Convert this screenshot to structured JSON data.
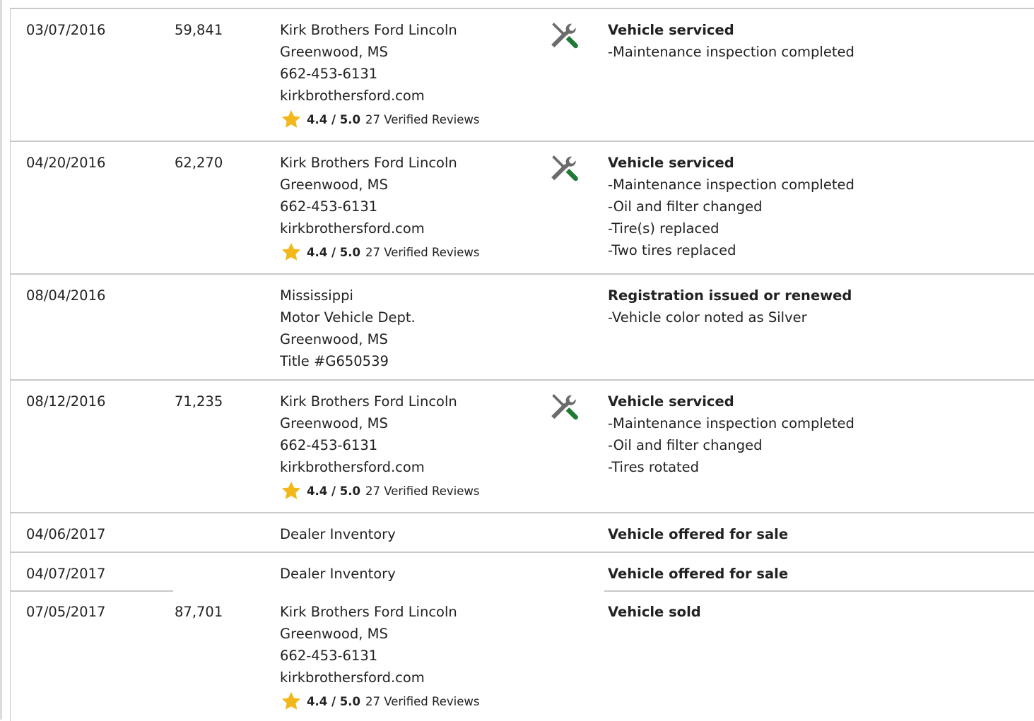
{
  "colors": {
    "star": "#f2b81b",
    "wrench_handle": "#1f7a35",
    "tool_gray": "#6b6b6b",
    "divider": "#c9c9c9"
  },
  "icons": {
    "service": "service-wrench-screwdriver-icon",
    "rating": "star-icon"
  },
  "rows": [
    {
      "date": "03/07/2016",
      "odometer": "59,841",
      "source": [
        "Kirk Brothers Ford Lincoln",
        "Greenwood, MS",
        "662-453-6131",
        "kirkbrothersford.com"
      ],
      "rating": {
        "score": "4.4 / 5.0",
        "reviews": "27 Verified Reviews"
      },
      "service_icon": true,
      "event": "Vehicle serviced",
      "details": [
        "-Maintenance inspection completed"
      ]
    },
    {
      "date": "04/20/2016",
      "odometer": "62,270",
      "source": [
        "Kirk Brothers Ford Lincoln",
        "Greenwood, MS",
        "662-453-6131",
        "kirkbrothersford.com"
      ],
      "rating": {
        "score": "4.4 / 5.0",
        "reviews": "27 Verified Reviews"
      },
      "service_icon": true,
      "event": "Vehicle serviced",
      "details": [
        "-Maintenance inspection completed",
        "-Oil and filter changed",
        "-Tire(s) replaced",
        "-Two tires replaced"
      ]
    },
    {
      "date": "08/04/2016",
      "odometer": "",
      "source": [
        "Mississippi",
        "Motor Vehicle Dept.",
        "Greenwood, MS",
        "Title #G650539"
      ],
      "rating": null,
      "service_icon": false,
      "event": "Registration issued or renewed",
      "details": [
        "-Vehicle color noted as Silver"
      ]
    },
    {
      "date": "08/12/2016",
      "odometer": "71,235",
      "source": [
        "Kirk Brothers Ford Lincoln",
        "Greenwood, MS",
        "662-453-6131",
        "kirkbrothersford.com"
      ],
      "rating": {
        "score": "4.4 / 5.0",
        "reviews": "27 Verified Reviews"
      },
      "service_icon": true,
      "event": "Vehicle serviced",
      "details": [
        "-Maintenance inspection completed",
        "-Oil and filter changed",
        "-Tires rotated"
      ]
    },
    {
      "date": "04/06/2017",
      "odometer": "",
      "source": [
        "Dealer Inventory"
      ],
      "rating": null,
      "service_icon": false,
      "event": "Vehicle offered for sale",
      "details": []
    },
    {
      "date": "04/07/2017",
      "odometer": "",
      "source": [
        "Dealer Inventory"
      ],
      "rating": null,
      "service_icon": false,
      "event": "Vehicle offered for sale",
      "details": []
    },
    {
      "date": "07/05/2017",
      "odometer": "87,701",
      "source": [
        "Kirk Brothers Ford Lincoln",
        "Greenwood, MS",
        "662-453-6131",
        "kirkbrothersford.com"
      ],
      "rating": {
        "score": "4.4 / 5.0",
        "reviews": "27 Verified Reviews"
      },
      "service_icon": false,
      "event": "Vehicle sold",
      "details": []
    }
  ]
}
